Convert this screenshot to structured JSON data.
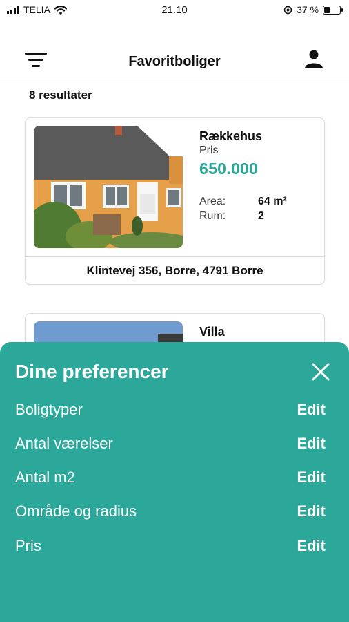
{
  "status_bar": {
    "carrier": "TELIA",
    "time": "21.10",
    "battery_percent": "37 %",
    "battery_level": 0.37
  },
  "header": {
    "title": "Favoritboliger",
    "menu_icon": "filter-menu-icon",
    "profile_icon": "user-icon"
  },
  "results_label": "8 resultater",
  "listings": [
    {
      "type": "Rækkehus",
      "price_label": "Pris",
      "price": "650.000",
      "area_label": "Area:",
      "area_value": "64 m²",
      "rooms_label": "Rum:",
      "rooms_value": "2",
      "address": "Klintevej 356, Borre, 4791 Borre"
    },
    {
      "type": "Villa"
    }
  ],
  "preferences": {
    "title": "Dine preferencer",
    "close_icon": "close-icon",
    "items": [
      {
        "label": "Boligtyper",
        "action": "Edit"
      },
      {
        "label": "Antal værelser",
        "action": "Edit"
      },
      {
        "label": "Antal m2",
        "action": "Edit"
      },
      {
        "label": "Område og radius",
        "action": "Edit"
      },
      {
        "label": "Pris",
        "action": "Edit"
      }
    ]
  },
  "colors": {
    "accent": "#2aa899",
    "sheet_background": "#2ba89a"
  }
}
